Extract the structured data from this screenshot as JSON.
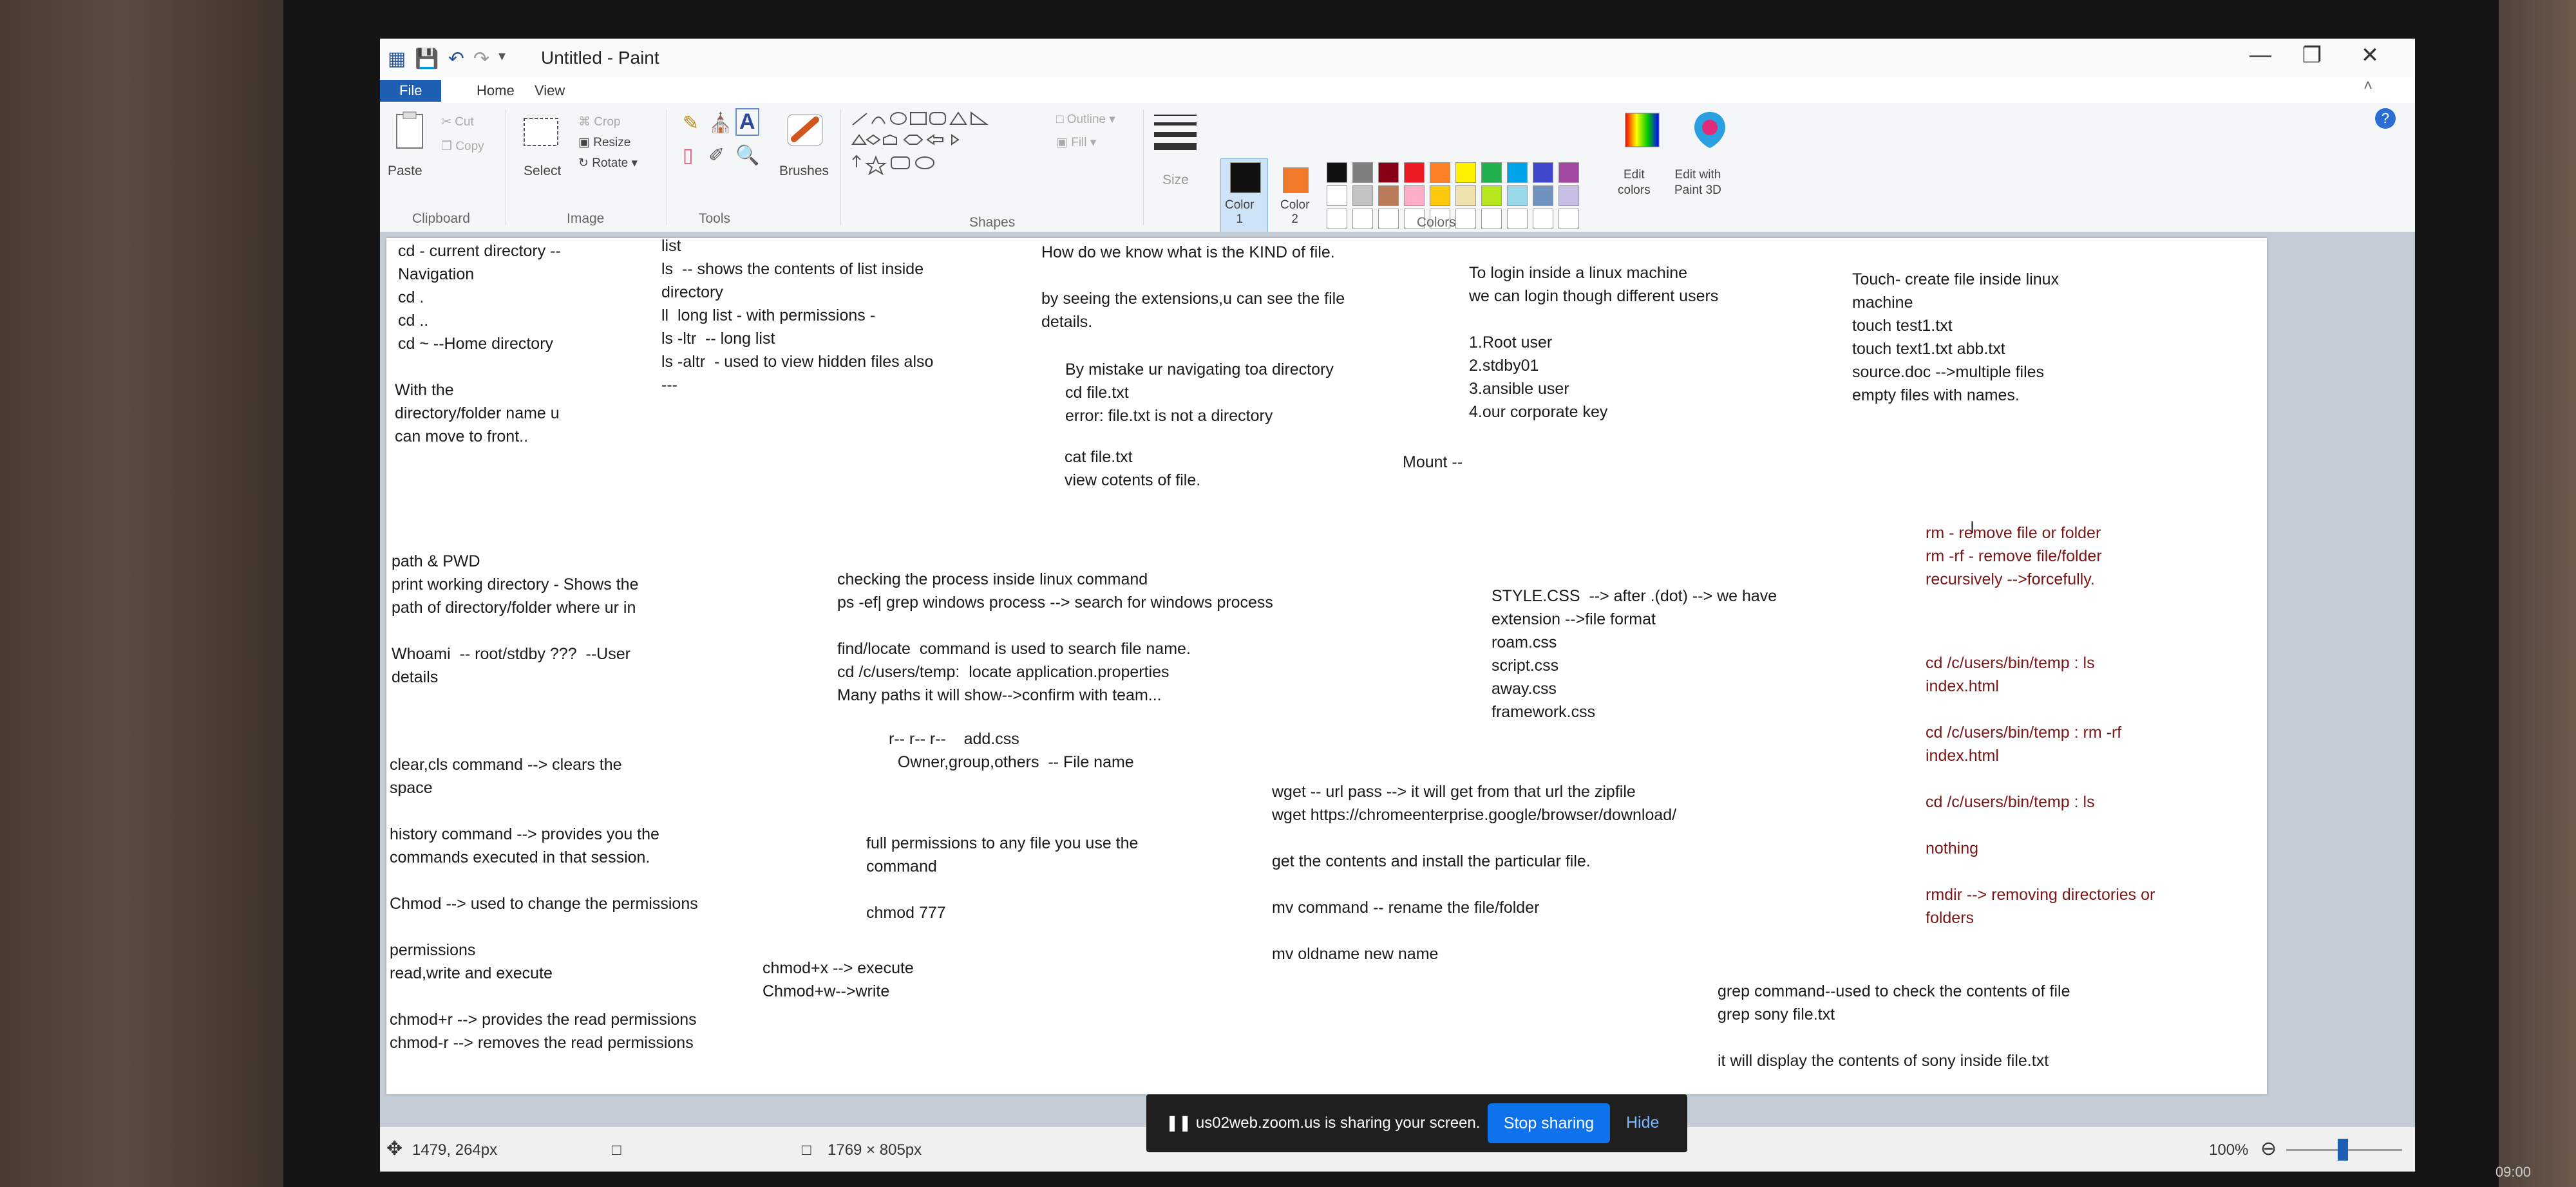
{
  "window": {
    "title": "Untitled - Paint"
  },
  "tabs": [
    {
      "label": "File"
    },
    {
      "label": "Home"
    },
    {
      "label": "View"
    }
  ],
  "ribbon": {
    "paste": "Paste",
    "cut": "Cut",
    "copy": "Copy",
    "select": "Select",
    "crop": "Crop",
    "resize": "Resize",
    "rotate": "Rotate",
    "brushes": "Brushes",
    "outline": "Outline",
    "fill": "Fill",
    "size": "Size",
    "color1": "Color\n1",
    "color2": "Color\n2",
    "edit_colors": "Edit\ncolors",
    "edit_paint3d": "Edit with\nPaint 3D",
    "groups": {
      "clipboard": "Clipboard",
      "image": "Image",
      "tools": "Tools",
      "shapes": "Shapes",
      "colors": "Colors"
    }
  },
  "palette": {
    "color1": "#111111",
    "color2": "#f07a2a",
    "row1": [
      "#111111",
      "#7f7f7f",
      "#880015",
      "#ed1c24",
      "#ff7f27",
      "#fff200",
      "#22b14c",
      "#00a2e8",
      "#3f48cc",
      "#a349a4"
    ],
    "row2": [
      "#ffffff",
      "#c3c3c3",
      "#b97a57",
      "#ffaec9",
      "#ffc90e",
      "#efe4b0",
      "#b5e61d",
      "#99d9ea",
      "#7092be",
      "#c8bfe7"
    ]
  },
  "notes": [
    {
      "text": "cd - current directory --\nNavigation\ncd .\ncd ..\ncd ~ --Home directory"
    },
    {
      "text": "With the\ndirectory/folder name u\ncan move to front.."
    },
    {
      "text": "list\nls  -- shows the contents of list inside\ndirectory\nll  long list - with permissions -\nls -ltr  -- long list\nls -altr  - used to view hidden files also\n---"
    },
    {
      "text": "How do we know what is the KIND of file.\n\nby seeing the extensions,u can see the file\ndetails."
    },
    {
      "text": "By mistake ur navigating toa directory\ncd file.txt\nerror: file.txt is not a directory"
    },
    {
      "text": "cat file.txt\nview cotents of file."
    },
    {
      "text": "To login inside a linux machine\nwe can login though different users\n\n1.Root user\n2.stdby01\n3.ansible user\n4.our corporate key"
    },
    {
      "text": "Touch- create file inside linux\nmachine\ntouch test1.txt\ntouch text1.txt abb.txt\nsource.doc -->multiple files\nempty files with names."
    },
    {
      "text": "Mount --"
    },
    {
      "text": "rm - remove file or folder\nrm -rf - remove file/folder\nrecursively -->forcefully."
    },
    {
      "text": "path & PWD\nprint working directory - Shows the\npath of directory/folder where ur in\n\nWhoami  -- root/stdby ???  --User\ndetails"
    },
    {
      "text": "checking the process inside linux command\nps -ef| grep windows process --> search for windows process\n\nfind/locate  command is used to search file name.\ncd /c/users/temp:  locate application.properties\nMany paths it will show-->confirm with team..."
    },
    {
      "text": "STYLE.CSS  --> after .(dot) --> we have\nextension -->file format\nroam.css\nscript.css\naway.css\nframework.css"
    },
    {
      "text": "cd /c/users/bin/temp : ls\nindex.html\n\ncd /c/users/bin/temp : rm -rf\nindex.html\n\ncd /c/users/bin/temp : ls\n\nnothing\n\nrmdir --> removing directories or\nfolders"
    },
    {
      "text": "r-- r-- r--    add.css\n  Owner,group,others  -- File name"
    },
    {
      "text": "clear,cls command --> clears the\nspace\n\nhistory command --> provides you the\ncommands executed in that session.\n\nChmod --> used to change the permissions\n\npermissions\nread,write and execute\n\nchmod+r --> provides the read permissions\nchmod-r --> removes the read permissions"
    },
    {
      "text": "full permissions to any file you use the\ncommand\n\nchmod 777"
    },
    {
      "text": "chmod+x --> execute\nChmod+w-->write"
    },
    {
      "text": "wget -- url pass --> it will get from that url the zipfile\nwget https://chromeenterprise.google/browser/download/\n\nget the contents and install the particular file.\n\nmv command -- rename the file/folder\n\nmv oldname new name"
    },
    {
      "text": "grep command--used to check the contents of file\ngrep sony file.txt\n\nit will display the contents of sony inside file.txt"
    }
  ],
  "status": {
    "cursor_pos": "1479, 264px",
    "canvas_size": "1769 × 805px",
    "zoom": "100%"
  },
  "share_bar": {
    "text": "us02web.zoom.us is sharing your screen.",
    "stop": "Stop sharing",
    "hide": "Hide"
  },
  "clock": "09:00"
}
